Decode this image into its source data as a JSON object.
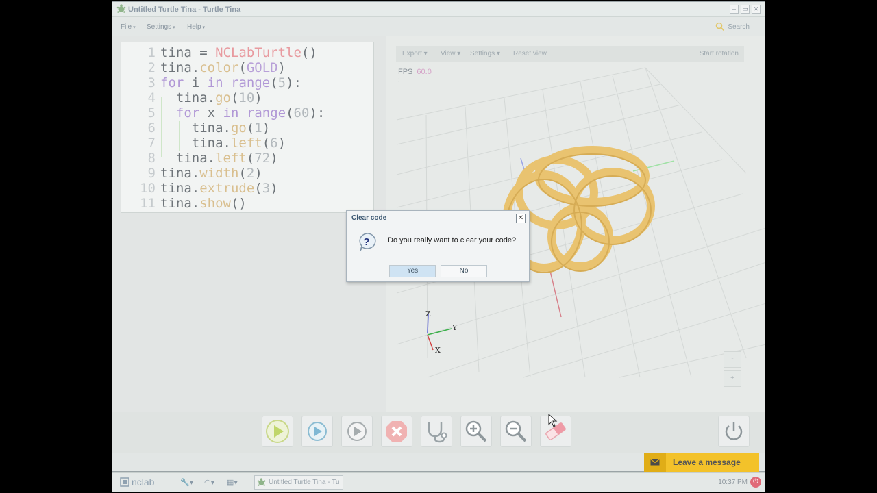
{
  "window": {
    "title": "Untitled Turtle Tina - Turtle Tina",
    "controls": [
      "–",
      "▭",
      "✕"
    ]
  },
  "menubar": {
    "items": [
      "File",
      "Settings",
      "Help"
    ],
    "search_label": "Search"
  },
  "editor": {
    "line_numbers": [
      "1",
      "2",
      "3",
      "4",
      "5",
      "6",
      "7",
      "8",
      "9",
      "10",
      "11"
    ]
  },
  "viewer": {
    "toolbar": {
      "export": "Export",
      "view": "View",
      "settings": "Settings",
      "reset_view": "Reset view",
      "start_rotation": "Start rotation"
    },
    "fps_label": "FPS",
    "fps_value": "60.0",
    "fps_sub": ":",
    "axis_labels": {
      "z": "Z",
      "y": "Y",
      "x": "X"
    },
    "zoom_minus": "-",
    "zoom_plus": "+",
    "model_color": "#e9c370"
  },
  "toolbar": {
    "buttons": [
      "run",
      "step-run",
      "play",
      "stop",
      "debug",
      "zoom-in",
      "zoom-out",
      "clear"
    ]
  },
  "dialog": {
    "title": "Clear code",
    "message": "Do you really want to clear your code?",
    "yes": "Yes",
    "no": "No",
    "close": "✕"
  },
  "chat": {
    "label": "Leave a message",
    "color": "#f3c22a"
  },
  "taskbar": {
    "logo_text": "nclab",
    "task_label": "Untitled Turtle Tina - Tu",
    "clock": "10:37 PM"
  }
}
